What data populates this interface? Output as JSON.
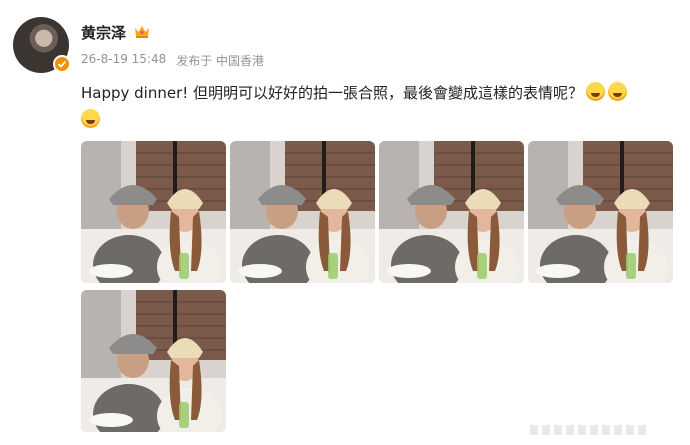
{
  "post": {
    "author": "黄宗泽",
    "date": "26-8-19 15:48",
    "source": "发布于 中国香港",
    "text": "Happy dinner! 但明明可以好好的拍一張合照，最後會變成這樣的表情呢？",
    "emojis": [
      "laugh-cry",
      "laugh-cry",
      "laugh-cry"
    ]
  },
  "colors": {
    "verified": "#f29100",
    "crown": "#f5a623",
    "meta": "#939393"
  },
  "photos": [
    {
      "name": "photo-1"
    },
    {
      "name": "photo-2"
    },
    {
      "name": "photo-3"
    },
    {
      "name": "photo-4"
    },
    {
      "name": "photo-5"
    }
  ]
}
